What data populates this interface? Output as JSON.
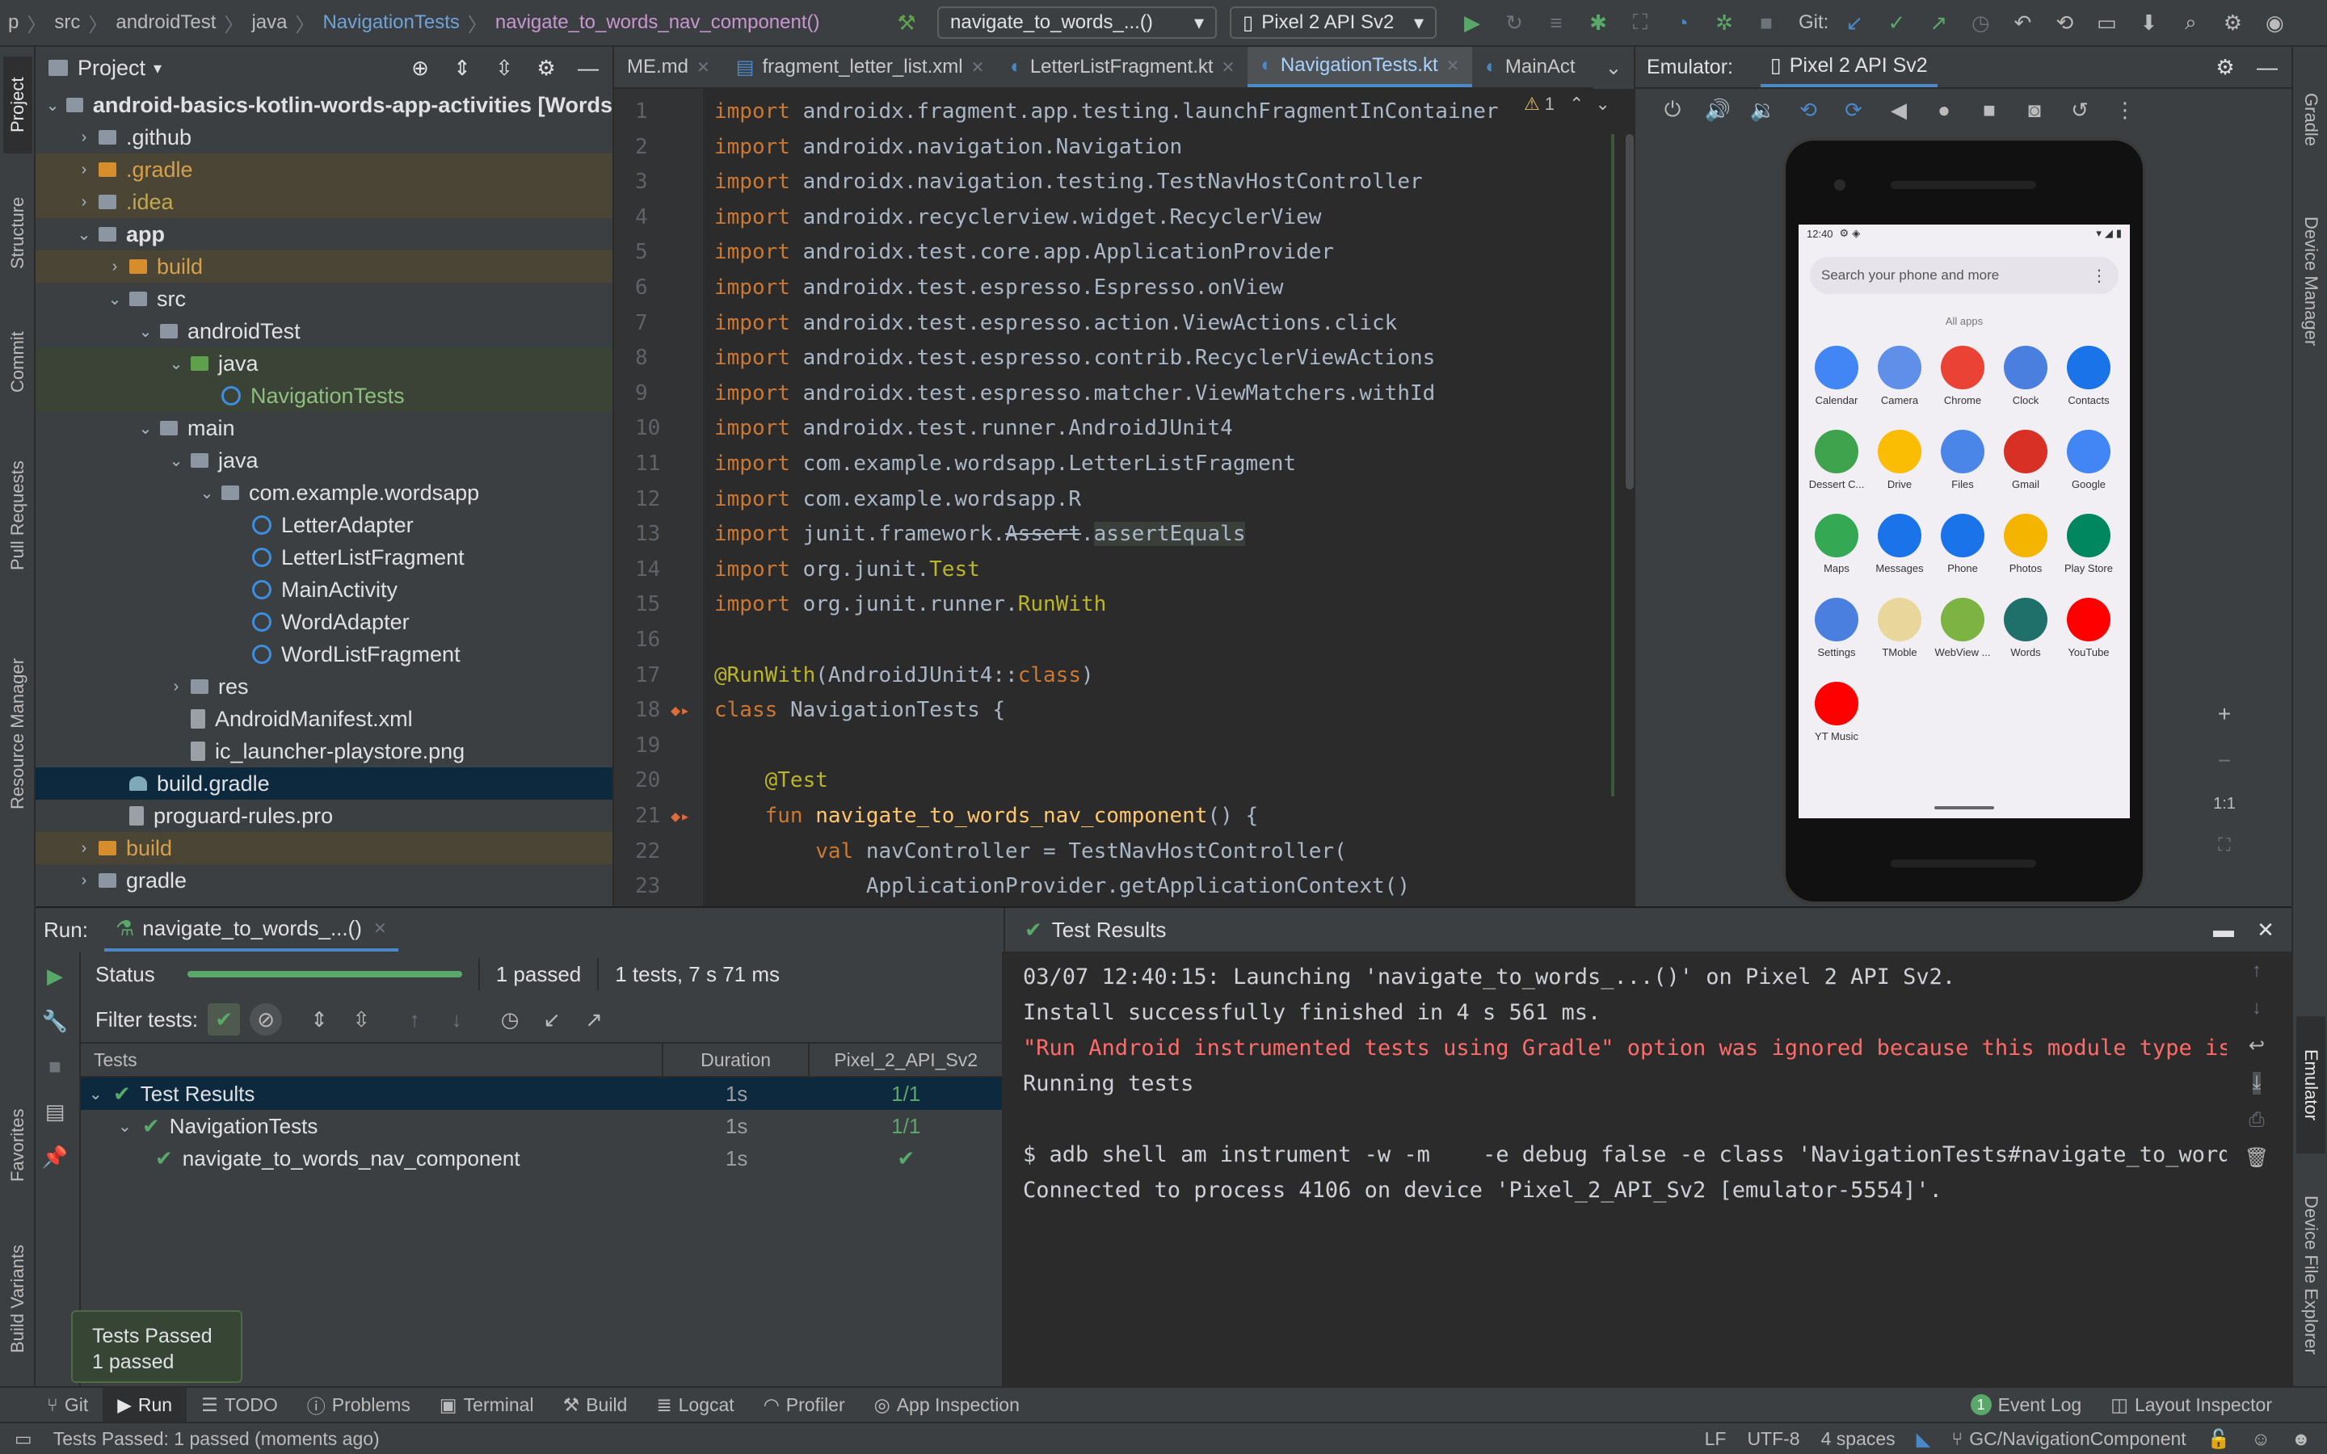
{
  "breadcrumb": [
    "p",
    "src",
    "androidTest",
    "java",
    "NavigationTests",
    "navigate_to_words_nav_component()"
  ],
  "toolbar": {
    "run_config": "navigate_to_words_...()",
    "device": "Pixel 2 API Sv2",
    "git_label": "Git:"
  },
  "project_panel": {
    "title": "Project",
    "tree": [
      {
        "label": "android-basics-kotlin-words-app-activities [Words",
        "depth": 0,
        "arrow": "open",
        "icon": "folder",
        "style": ""
      },
      {
        "label": ".github",
        "depth": 1,
        "arrow": "closed",
        "icon": "folder",
        "style": ""
      },
      {
        "label": ".gradle",
        "depth": 1,
        "arrow": "closed",
        "icon": "orange",
        "style": "hl-orange"
      },
      {
        "label": ".idea",
        "depth": 1,
        "arrow": "closed",
        "icon": "folder",
        "style": "hl-orange"
      },
      {
        "label": "app",
        "depth": 1,
        "arrow": "open",
        "icon": "folder",
        "style": ""
      },
      {
        "label": "build",
        "depth": 2,
        "arrow": "closed",
        "icon": "orange",
        "style": "hl-orange"
      },
      {
        "label": "src",
        "depth": 2,
        "arrow": "open",
        "icon": "folder",
        "style": ""
      },
      {
        "label": "androidTest",
        "depth": 3,
        "arrow": "open",
        "icon": "folder",
        "style": ""
      },
      {
        "label": "java",
        "depth": 4,
        "arrow": "open",
        "icon": "green",
        "style": "hl-green"
      },
      {
        "label": "NavigationTests",
        "depth": 5,
        "arrow": "",
        "icon": "kt",
        "style": "hl-green"
      },
      {
        "label": "main",
        "depth": 3,
        "arrow": "open",
        "icon": "folder",
        "style": ""
      },
      {
        "label": "java",
        "depth": 4,
        "arrow": "open",
        "icon": "folder",
        "style": ""
      },
      {
        "label": "com.example.wordsapp",
        "depth": 5,
        "arrow": "open",
        "icon": "folder",
        "style": ""
      },
      {
        "label": "LetterAdapter",
        "depth": 6,
        "arrow": "",
        "icon": "kt",
        "style": ""
      },
      {
        "label": "LetterListFragment",
        "depth": 6,
        "arrow": "",
        "icon": "kt",
        "style": ""
      },
      {
        "label": "MainActivity",
        "depth": 6,
        "arrow": "",
        "icon": "kt",
        "style": ""
      },
      {
        "label": "WordAdapter",
        "depth": 6,
        "arrow": "",
        "icon": "kt",
        "style": ""
      },
      {
        "label": "WordListFragment",
        "depth": 6,
        "arrow": "",
        "icon": "kt",
        "style": ""
      },
      {
        "label": "res",
        "depth": 4,
        "arrow": "closed",
        "icon": "folder",
        "style": ""
      },
      {
        "label": "AndroidManifest.xml",
        "depth": 4,
        "arrow": "",
        "icon": "file",
        "style": ""
      },
      {
        "label": "ic_launcher-playstore.png",
        "depth": 4,
        "arrow": "",
        "icon": "file",
        "style": ""
      },
      {
        "label": "build.gradle",
        "depth": 2,
        "arrow": "",
        "icon": "gradle",
        "style": "sel"
      },
      {
        "label": "proguard-rules.pro",
        "depth": 2,
        "arrow": "",
        "icon": "file",
        "style": ""
      },
      {
        "label": "build",
        "depth": 1,
        "arrow": "closed",
        "icon": "orange",
        "style": "hl-orange"
      },
      {
        "label": "gradle",
        "depth": 1,
        "arrow": "closed",
        "icon": "folder",
        "style": ""
      }
    ]
  },
  "editor": {
    "tabs": [
      {
        "label": "ME.md",
        "active": false
      },
      {
        "label": "fragment_letter_list.xml",
        "active": false
      },
      {
        "label": "LetterListFragment.kt",
        "active": false
      },
      {
        "label": "NavigationTests.kt",
        "active": true
      },
      {
        "label": "MainAct",
        "active": false
      }
    ],
    "warning_count": "1",
    "lines": [
      {
        "n": "1",
        "code": "import androidx.fragment.app.testing.launchFragmentInContainer"
      },
      {
        "n": "2",
        "code": "import androidx.navigation.Navigation"
      },
      {
        "n": "3",
        "code": "import androidx.navigation.testing.TestNavHostController"
      },
      {
        "n": "4",
        "code": "import androidx.recyclerview.widget.RecyclerView"
      },
      {
        "n": "5",
        "code": "import androidx.test.core.app.ApplicationProvider"
      },
      {
        "n": "6",
        "code": "import androidx.test.espresso.Espresso.onView"
      },
      {
        "n": "7",
        "code": "import androidx.test.espresso.action.ViewActions.click"
      },
      {
        "n": "8",
        "code": "import androidx.test.espresso.contrib.RecyclerViewActions"
      },
      {
        "n": "9",
        "code": "import androidx.test.espresso.matcher.ViewMatchers.withId"
      },
      {
        "n": "10",
        "code": "import androidx.test.runner.AndroidJUnit4"
      },
      {
        "n": "11",
        "code": "import com.example.wordsapp.LetterListFragment"
      },
      {
        "n": "12",
        "code": "import com.example.wordsapp.R"
      },
      {
        "n": "13",
        "code": "import junit.framework.Assert.assertEquals"
      },
      {
        "n": "14",
        "code": "import org.junit.Test"
      },
      {
        "n": "15",
        "code": "import org.junit.runner.RunWith"
      },
      {
        "n": "16",
        "code": ""
      },
      {
        "n": "17",
        "code": "@RunWith(AndroidJUnit4::class)"
      },
      {
        "n": "18",
        "code": "class NavigationTests {"
      },
      {
        "n": "19",
        "code": ""
      },
      {
        "n": "20",
        "code": "    @Test"
      },
      {
        "n": "21",
        "code": "    fun navigate_to_words_nav_component() {"
      },
      {
        "n": "22",
        "code": "        val navController = TestNavHostController("
      },
      {
        "n": "23",
        "code": "            ApplicationProvider.getApplicationContext()"
      }
    ]
  },
  "emulator": {
    "title": "Emulator:",
    "device_tab": "Pixel 2 API Sv2",
    "phone": {
      "time": "12:40",
      "search_placeholder": "Search your phone and more",
      "all_apps": "All apps",
      "apps": [
        {
          "name": "Calendar",
          "color": "#4285f4"
        },
        {
          "name": "Camera",
          "color": "#5f8fe8"
        },
        {
          "name": "Chrome",
          "color": "#ea4335"
        },
        {
          "name": "Clock",
          "color": "#4a7fe0"
        },
        {
          "name": "Contacts",
          "color": "#1a73e8"
        },
        {
          "name": "Dessert C...",
          "color": "#3fa34d"
        },
        {
          "name": "Drive",
          "color": "#fbbc04"
        },
        {
          "name": "Files",
          "color": "#4a86e8"
        },
        {
          "name": "Gmail",
          "color": "#d93025"
        },
        {
          "name": "Google",
          "color": "#4285f4"
        },
        {
          "name": "Maps",
          "color": "#34a853"
        },
        {
          "name": "Messages",
          "color": "#1a73e8"
        },
        {
          "name": "Phone",
          "color": "#1a73e8"
        },
        {
          "name": "Photos",
          "color": "#f4b400"
        },
        {
          "name": "Play Store",
          "color": "#01875f"
        },
        {
          "name": "Settings",
          "color": "#4a7fe0"
        },
        {
          "name": "TMoble",
          "color": "#e8d69a"
        },
        {
          "name": "WebView ...",
          "color": "#7cb342"
        },
        {
          "name": "Words",
          "color": "#1f6f6a"
        },
        {
          "name": "YouTube",
          "color": "#ff0000"
        },
        {
          "name": "YT Music",
          "color": "#ff0000"
        }
      ]
    },
    "zoom_label": "1:1"
  },
  "run_panel": {
    "label": "Run:",
    "config_tab": "navigate_to_words_...()",
    "status_label": "Status",
    "progress": 1.0,
    "passed_label": "1 passed",
    "summary": "1 tests, 7 s 71 ms",
    "filter_label": "Filter tests:",
    "columns": [
      "Tests",
      "Duration",
      "Pixel_2_API_Sv2"
    ],
    "rows": [
      {
        "name": "Test Results",
        "duration": "1s",
        "result": "1/1",
        "depth": 0
      },
      {
        "name": "NavigationTests",
        "duration": "1s",
        "result": "1/1",
        "depth": 1
      },
      {
        "name": "navigate_to_words_nav_component",
        "duration": "1s",
        "result": "✔",
        "depth": 2
      }
    ],
    "console_title": "Test Results",
    "console": [
      {
        "text": "03/07 12:40:15: Launching 'navigate_to_words_...()' on Pixel 2 API Sv2.",
        "error": false
      },
      {
        "text": "Install successfully finished in 4 s 561 ms.",
        "error": false
      },
      {
        "text": "\"Run Android instrumented tests using Gradle\" option was ignored because this module type is no",
        "error": true
      },
      {
        "text": "Running tests",
        "error": false
      },
      {
        "text": "",
        "error": false
      },
      {
        "text": "$ adb shell am instrument -w -m    -e debug false -e class 'NavigationTests#navigate_to_words_n",
        "error": false
      },
      {
        "text": "Connected to process 4106 on device 'Pixel_2_API_Sv2 [emulator-5554]'.",
        "error": false
      }
    ]
  },
  "tooltip": {
    "line1": "Tests Passed",
    "line2": "1 passed"
  },
  "left_tools": [
    "Project",
    "Structure",
    "Commit",
    "Pull Requests",
    "Resource Manager",
    "Favorites",
    "Build Variants"
  ],
  "right_tools": [
    "Gradle",
    "Device Manager",
    "Emulator",
    "Device File Explorer"
  ],
  "bottom_tools": [
    "Git",
    "Run",
    "TODO",
    "Problems",
    "Terminal",
    "Build",
    "Logcat",
    "Profiler",
    "App Inspection"
  ],
  "bottom_right_tools": [
    "Event Log",
    "Layout Inspector"
  ],
  "event_log_count": "1",
  "status_bar": {
    "message": "Tests Passed: 1 passed (moments ago)",
    "line_sep": "LF",
    "encoding": "UTF-8",
    "indent": "4 spaces",
    "branch": "GC/NavigationComponent"
  }
}
